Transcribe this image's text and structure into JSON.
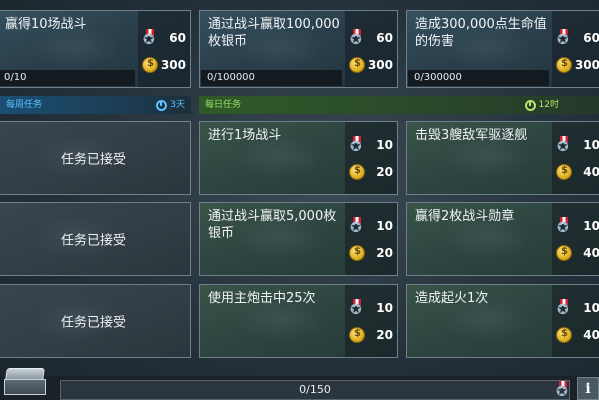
{
  "weekly_cards": [
    {
      "title": "赢得10场战斗",
      "progress": "0/10",
      "medal": "60",
      "coins": "300"
    },
    {
      "title": "通过战斗赢取100,000枚银币",
      "progress": "0/100000",
      "medal": "60",
      "coins": "300"
    },
    {
      "title": "造成300,000点生命值的伤害",
      "progress": "0/300000",
      "medal": "60",
      "coins": "300"
    }
  ],
  "weekly_header": {
    "label": "每周任务",
    "timer": "3天"
  },
  "daily_header": {
    "label": "每日任务",
    "timer": "12时"
  },
  "accepted_label": "任务已接受",
  "daily_cards": [
    {
      "title": "进行1场战斗",
      "medal": "10",
      "coins": "20"
    },
    {
      "title": "击毁3艘敌军驱逐舰",
      "medal": "10",
      "coins": "40"
    },
    {
      "title": "通过战斗赢取5,000枚银币",
      "medal": "10",
      "coins": "20"
    },
    {
      "title": "赢得2枚战斗勋章",
      "medal": "10",
      "coins": "40"
    },
    {
      "title": "使用主炮击中25次",
      "medal": "10",
      "coins": "20"
    },
    {
      "title": "造成起火1次",
      "medal": "10",
      "coins": "40"
    }
  ],
  "footer": {
    "progress": "0/150",
    "info_label": "i"
  },
  "colors": {
    "weekly_accent": "#58c3ff",
    "daily_accent": "#9ae06a"
  }
}
